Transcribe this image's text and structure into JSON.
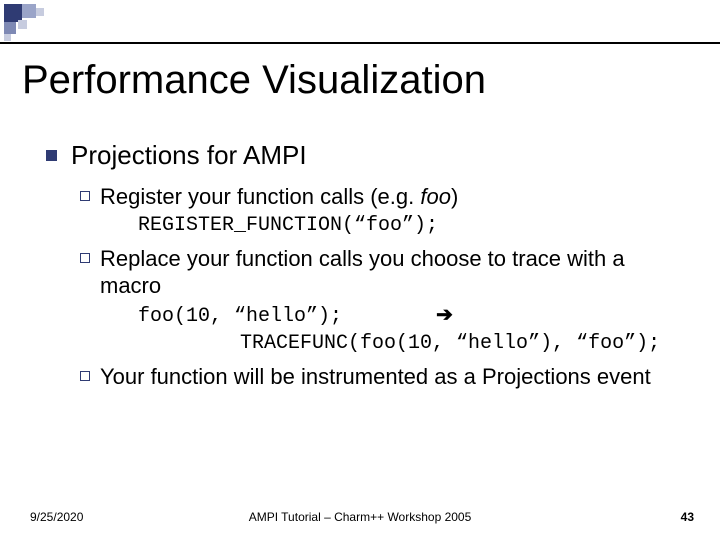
{
  "title": "Performance Visualization",
  "lvl1": "Projections for AMPI",
  "sub1_pre": "Register your function calls (e.g. ",
  "sub1_it": "foo",
  "sub1_post": ")",
  "code1": "REGISTER_FUNCTION(“foo”);",
  "sub2": "Replace your function calls you choose to trace with a macro",
  "code2a": "foo(10, “hello”);",
  "arrow": "➔",
  "code2b": "TRACEFUNC(foo(10, “hello”), “foo”);",
  "sub3": "Your function will be instrumented as a Projections event",
  "footer": {
    "date": "9/25/2020",
    "center": "AMPI Tutorial – Charm++ Workshop 2005",
    "page": "43"
  }
}
